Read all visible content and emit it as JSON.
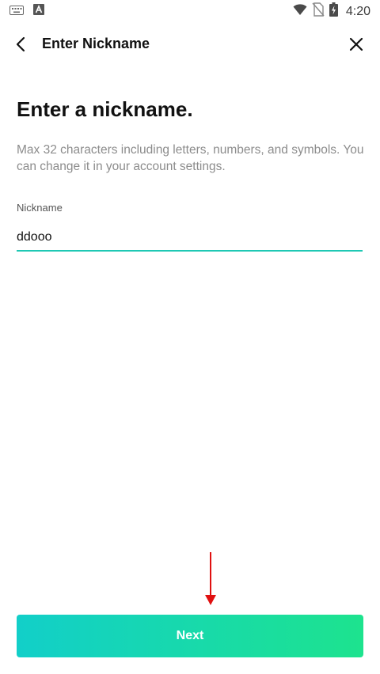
{
  "status_bar": {
    "time": "4:20",
    "icons": [
      "keyboard-icon",
      "text-a-icon",
      "wifi-icon",
      "no-sim-icon",
      "battery-charging-icon"
    ]
  },
  "app_bar": {
    "title": "Enter Nickname",
    "back_icon": "chevron-left-icon",
    "close_icon": "close-icon"
  },
  "content": {
    "heading": "Enter a nickname.",
    "description": "Max 32 characters including letters, numbers, and symbols. You can change it in your account settings."
  },
  "nickname_field": {
    "label": "Nickname",
    "value": "ddooo",
    "underline_color": "#1fc8b4"
  },
  "next_button": {
    "label": "Next",
    "gradient_start": "#12cfc9",
    "gradient_end": "#1de38e"
  },
  "annotation": {
    "arrow_color": "#e01010",
    "icon": "down-arrow-icon"
  }
}
